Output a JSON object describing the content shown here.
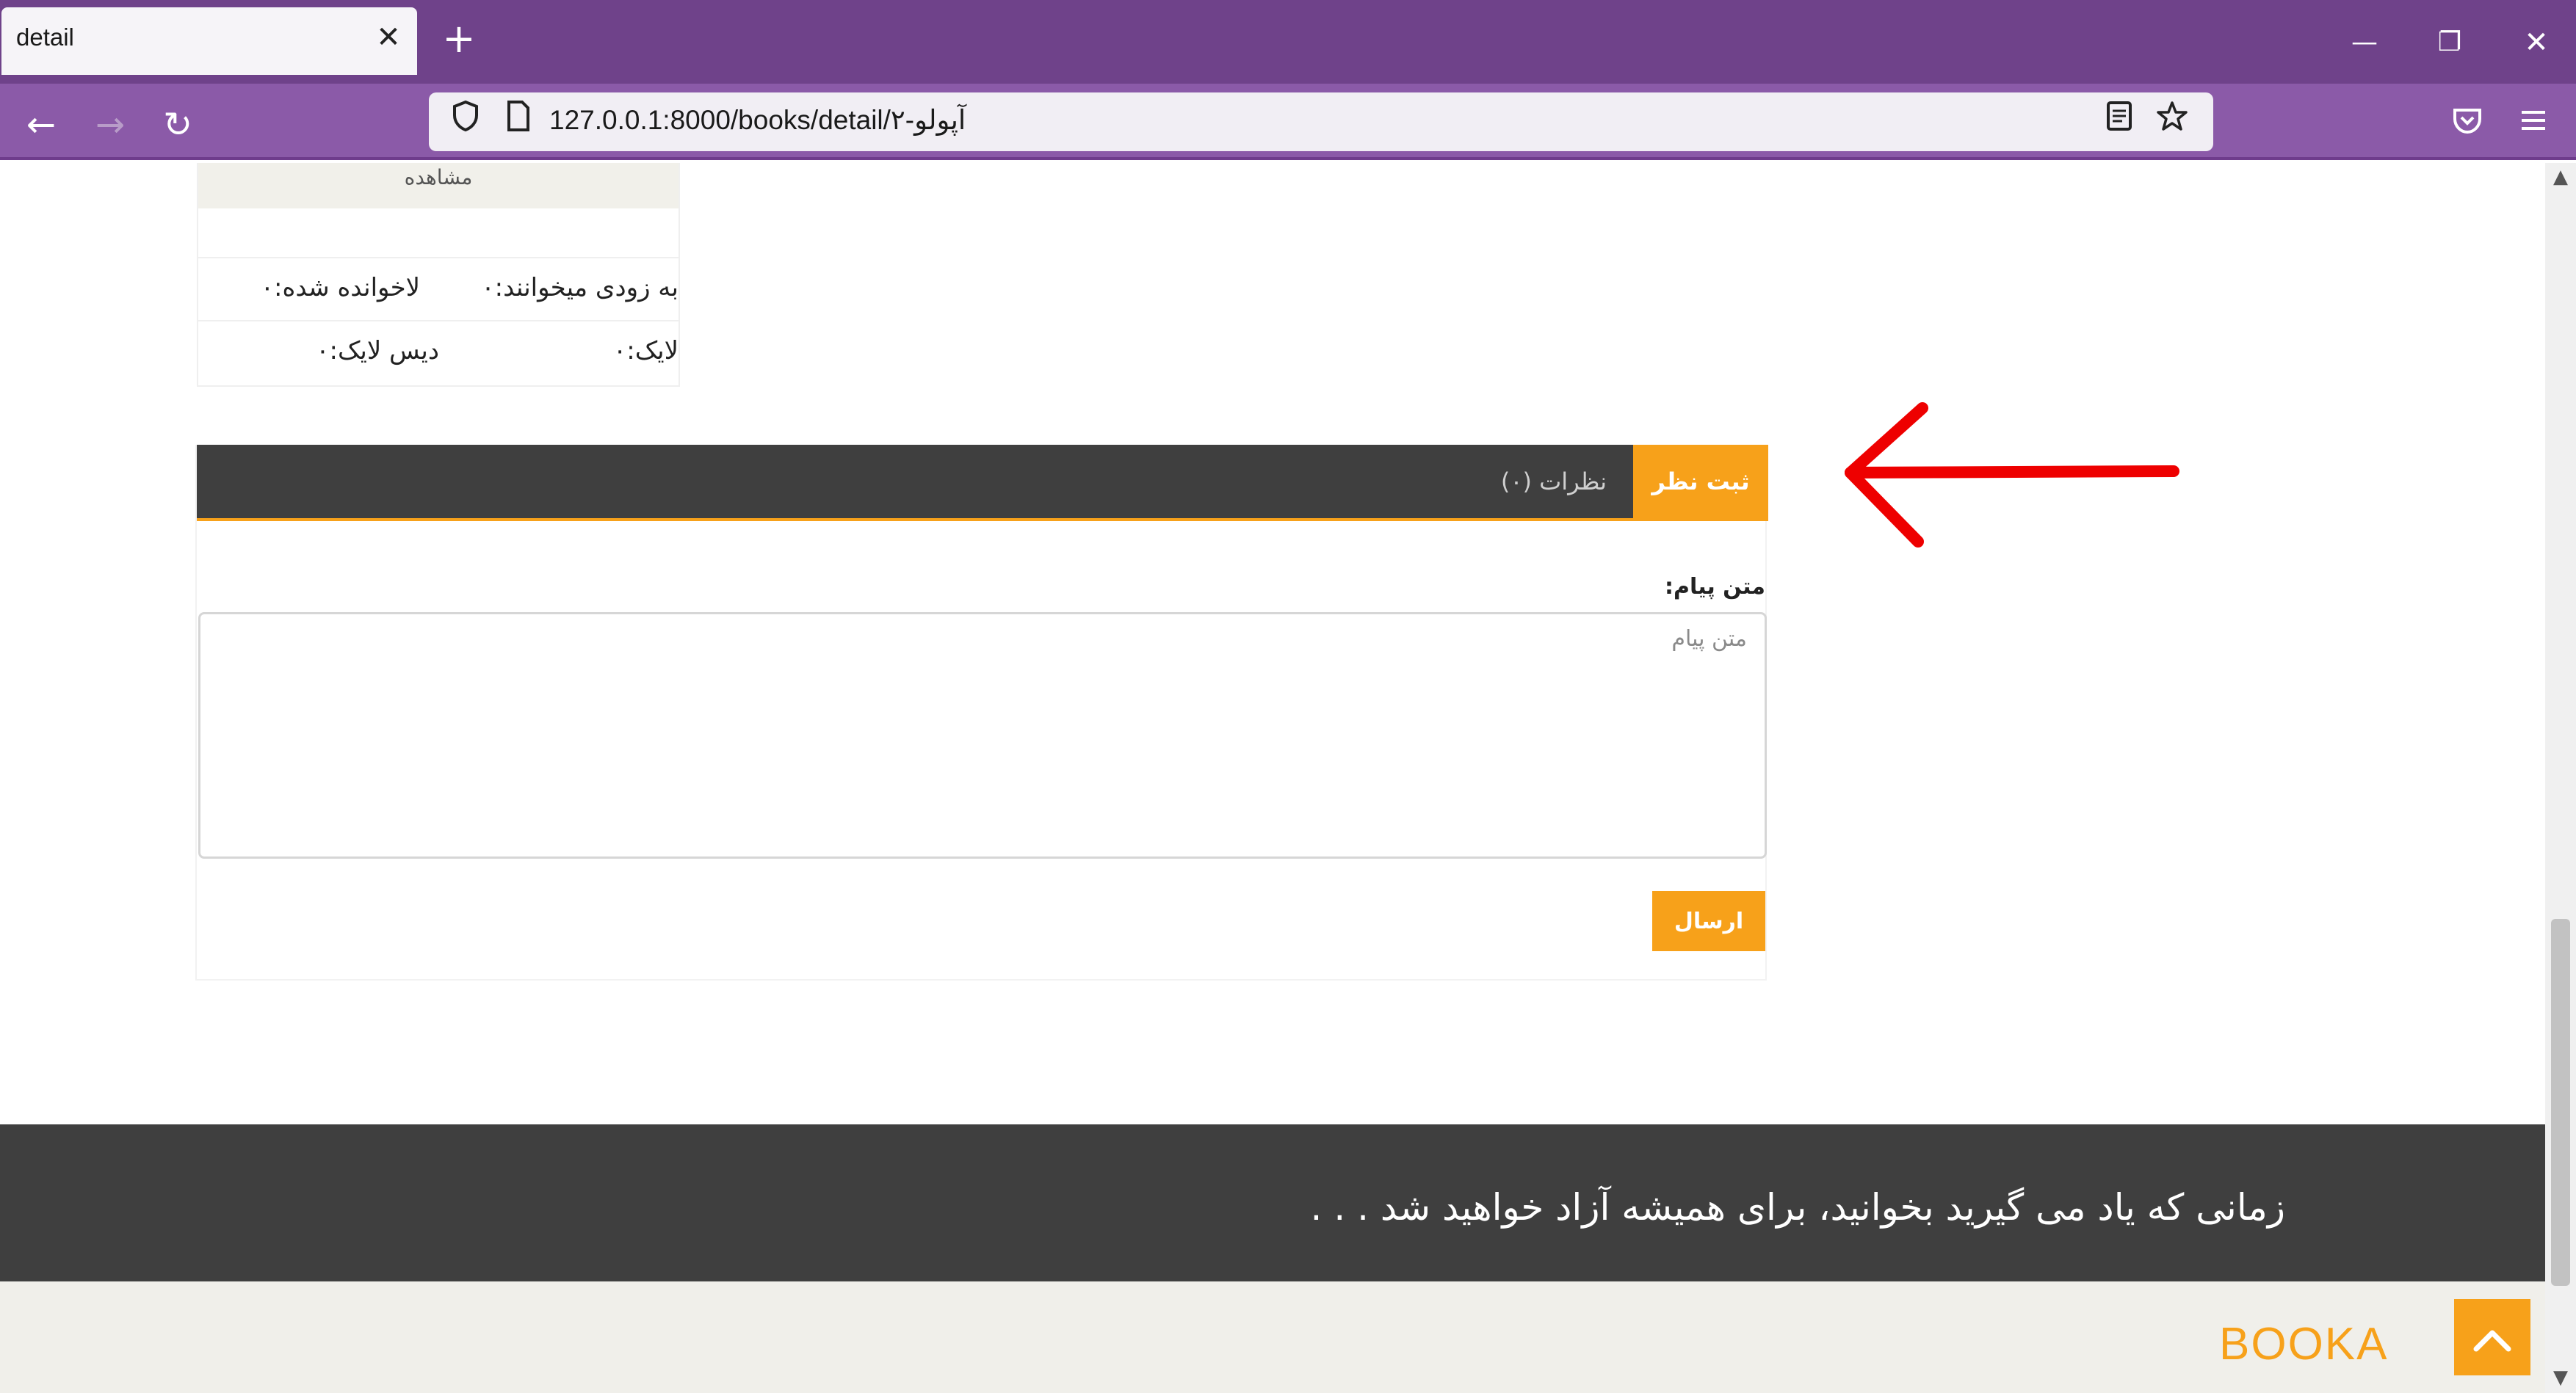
{
  "browser": {
    "tab_title": "detail",
    "tab_close": "✕",
    "new_tab": "+",
    "url": "127.0.0.1:8000/books/detail/آپولو-۲",
    "window_controls": {
      "minimize": "—",
      "restore": "❐",
      "close": "✕"
    },
    "nav": {
      "back": "←",
      "forward": "→",
      "reload": "↻"
    },
    "icons": {
      "shield": "shield-icon",
      "page": "page-icon",
      "reader": "reader-view-icon",
      "star": "bookmark-star-icon",
      "pocket": "pocket-icon",
      "menu": "hamburger-menu-icon"
    }
  },
  "stats": {
    "header": "مشاهده",
    "reading_soon": "به زودی میخوانند:۰",
    "read": "لاخوانده شده:۰",
    "likes": "لایک:۰",
    "dislikes": "دیس لایک:۰"
  },
  "comments": {
    "tab_submit": "ثبت نظر",
    "tab_comments": "نظرات (۰)",
    "message_label": "متن پیام:",
    "message_placeholder": "متن پیام",
    "message_value": "",
    "send_label": "ارسال"
  },
  "footer": {
    "quote": "زمانی که یاد می گیرید بخوانید، برای همیشه آزاد خواهید شد . . .",
    "brand": "BOOKA"
  },
  "colors": {
    "browser_tabbar": "#6f428a",
    "browser_navbar": "#8b5aa8",
    "accent_orange": "#f7a11a",
    "dark_panel": "#3f3f3f",
    "annotation_red": "#ee0000"
  }
}
